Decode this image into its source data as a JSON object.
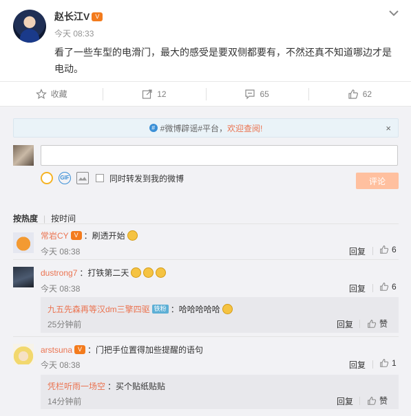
{
  "post": {
    "author": "赵长江V",
    "time": "今天 08:33",
    "text": "看了一些车型的电滑门，最大的感受是要双侧都要有，不然还真不知道哪边才是电动。"
  },
  "actions": {
    "favorite_label": "收藏",
    "repost_count": "12",
    "comment_count": "65",
    "like_count": "62"
  },
  "notice": {
    "text": "#微博辟谣#平台，",
    "link": "欢迎查阅!",
    "close": "×"
  },
  "composer": {
    "placeholder": "",
    "repost_label": "同时转发到我的微博",
    "submit_label": "评论"
  },
  "sort": {
    "hot": "按热度",
    "time": "按时间"
  },
  "comments": [
    {
      "name": "常岩CY",
      "text": "：刷透开始",
      "time": "今天 08:38",
      "reply": "回复",
      "likes": "6"
    },
    {
      "name": "dustrong7",
      "text": "：打铁第二天",
      "time": "今天 08:38",
      "reply": "回复",
      "likes": "6",
      "sub": {
        "name": "九五先森再等汉dm三擎四驱",
        "badge": "铁粉",
        "text": "：哈哈哈哈哈",
        "time": "25分钟前",
        "reply": "回复",
        "like": "赞"
      }
    },
    {
      "name": "arstsuna",
      "text": "：门把手位置得加些提醒的语句",
      "time": "今天 08:38",
      "reply": "回复",
      "likes": "1",
      "sub": {
        "name": "凭栏听雨一场空",
        "text": "：买个贴纸贴贴",
        "time": "14分钟前",
        "reply": "回复",
        "like": "赞"
      }
    }
  ]
}
